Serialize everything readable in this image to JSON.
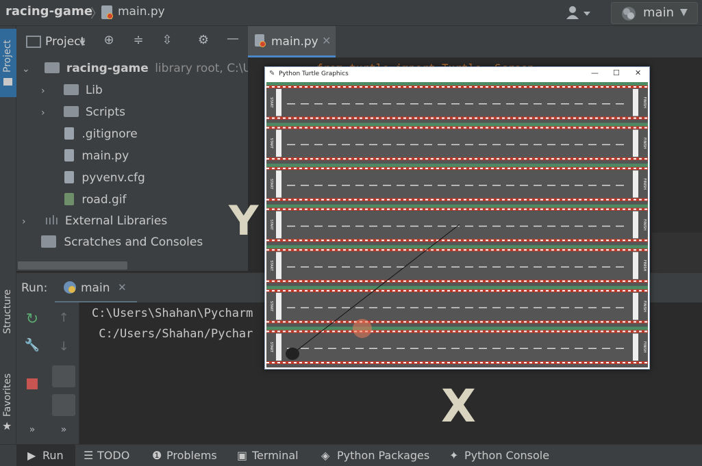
{
  "navbar": {
    "project": "racing-game",
    "separator": "〉",
    "file": "main.py",
    "branch": "main"
  },
  "left_strip": {
    "project_tab": "Project",
    "structure_tab": "Structure",
    "favorites_tab": "Favorites"
  },
  "project_panel": {
    "dropdown_label": "Project",
    "tree": [
      {
        "name": "racing-game",
        "hint": "library root,  C:\\Us",
        "type": "root"
      },
      {
        "name": "Lib",
        "type": "folder"
      },
      {
        "name": "Scripts",
        "type": "folder"
      },
      {
        "name": ".gitignore",
        "type": "file"
      },
      {
        "name": "main.py",
        "type": "python"
      },
      {
        "name": "pyvenv.cfg",
        "type": "file"
      },
      {
        "name": "road.gif",
        "type": "image"
      },
      {
        "name": "External Libraries",
        "type": "library"
      },
      {
        "name": "Scratches and Consoles",
        "type": "scratch"
      }
    ]
  },
  "editor": {
    "tab_label": "main.py",
    "code_line": "from turtle import Turtle, Screen"
  },
  "run_panel": {
    "label": "Run:",
    "config": "main",
    "output": [
      "C:\\Users\\Shahan\\Pycharm",
      " C:/Users/Shahan/Pychar"
    ]
  },
  "bottom_bar": {
    "run": "Run",
    "todo": "TODO",
    "problems": "Problems",
    "terminal": "Terminal",
    "packages": "Python Packages",
    "console": "Python Console"
  },
  "turtle_window": {
    "title": "Python Turtle Graphics",
    "lane_count": 7,
    "start_label": "START",
    "finish_label": "FINISH"
  },
  "overlay": {
    "y_axis": "Y",
    "x_axis": "X"
  },
  "colors": {
    "ide_bg": "#2b2b2b",
    "panel_bg": "#3c3f41",
    "track_asphalt": "#555555",
    "track_green": "#4d8a63",
    "curb_red": "#c0392b",
    "accent_blue": "#4a88c7"
  }
}
